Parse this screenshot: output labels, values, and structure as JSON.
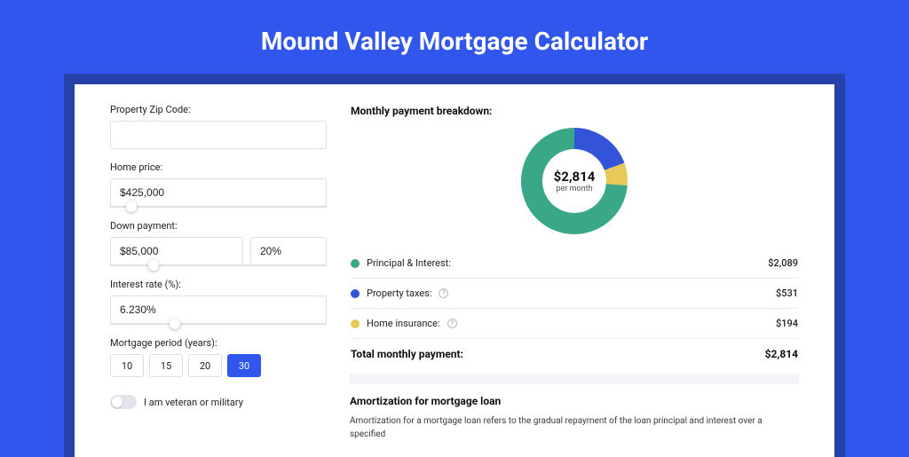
{
  "title": "Mound Valley Mortgage Calculator",
  "form": {
    "zip_label": "Property Zip Code:",
    "zip_value": "",
    "home_price_label": "Home price:",
    "home_price_value": "$425,000",
    "home_price_slider_pct": 10,
    "down_payment_label": "Down payment:",
    "down_payment_value": "$85,000",
    "down_payment_pct": "20%",
    "down_payment_slider_pct": 20,
    "interest_label": "Interest rate (%):",
    "interest_value": "6.230%",
    "interest_slider_pct": 30,
    "period_label": "Mortgage period (years):",
    "period_options": [
      "10",
      "15",
      "20",
      "30"
    ],
    "period_selected": "30",
    "veteran_label": "I am veteran or military"
  },
  "breakdown": {
    "title": "Monthly payment breakdown:",
    "donut_value": "$2,814",
    "donut_sub": "per month",
    "rows": {
      "pi": {
        "label": "Principal & Interest:",
        "value": "$2,089"
      },
      "tax": {
        "label": "Property taxes:",
        "value": "$531"
      },
      "ins": {
        "label": "Home insurance:",
        "value": "$194"
      }
    },
    "total_label": "Total monthly payment:",
    "total_value": "$2,814"
  },
  "amort": {
    "heading": "Amortization for mortgage loan",
    "body": "Amortization for a mortgage loan refers to the gradual repayment of the loan principal and interest over a specified"
  },
  "chart_data": {
    "type": "pie",
    "title": "Monthly payment breakdown",
    "series": [
      {
        "name": "Principal & Interest",
        "value": 2089,
        "color": "#3aa789"
      },
      {
        "name": "Property taxes",
        "value": 531,
        "color": "#3353d8"
      },
      {
        "name": "Home insurance",
        "value": 194,
        "color": "#e9c85a"
      }
    ],
    "total": 2814,
    "center_label": "$2,814 per month"
  }
}
